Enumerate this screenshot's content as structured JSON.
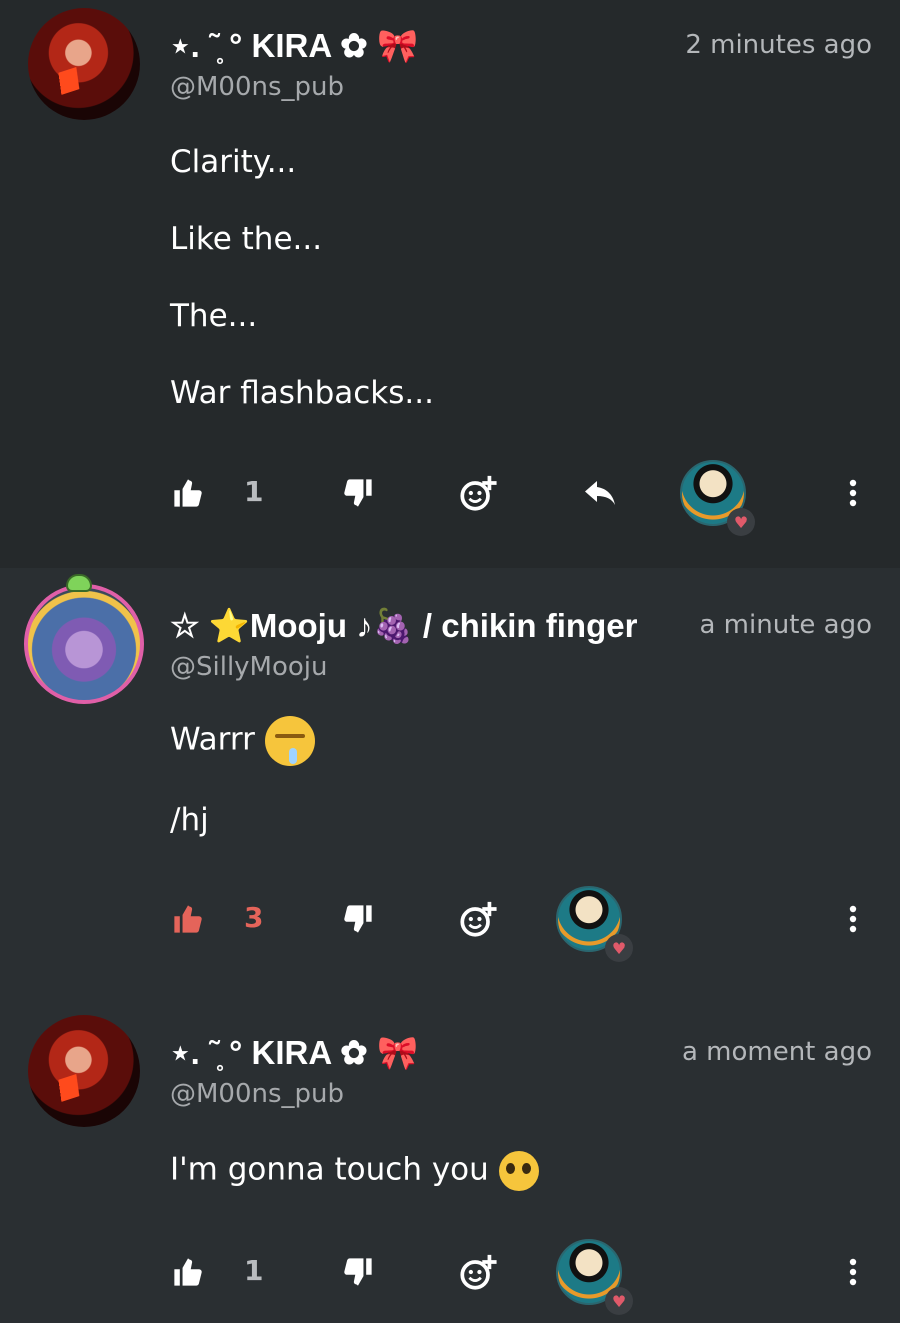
{
  "colors": {
    "background": "#262a2d",
    "text": "#ffffff",
    "muted": "#a6a9ac",
    "liked_accent": "#e4645a"
  },
  "posts": [
    {
      "display_name": "⋆. ῀̥ ° KIRA ✿ 🎀",
      "handle": "@M00ns_pub",
      "time": "2 minutes ago",
      "lines": [
        "Clarity...",
        "Like the...",
        "The...",
        "War flashbacks..."
      ],
      "like_count": "1",
      "liked": false,
      "icons": [
        "thumb-up-icon",
        "thumb-down-icon",
        "add-reaction-icon",
        "reply-icon",
        "more-vertical-icon"
      ]
    },
    {
      "display_name": "☆ ⭐Mooju ♪🍇 / chikin finger",
      "handle": "@SillyMooju",
      "time": "a minute ago",
      "lines": [
        "Warrr",
        "/hj"
      ],
      "emoji": "drooling-face",
      "like_count": "3",
      "liked": true,
      "icons": [
        "thumb-up-icon",
        "thumb-down-icon",
        "add-reaction-icon",
        "more-vertical-icon"
      ]
    },
    {
      "display_name": "⋆. ῀̥ ° KIRA ✿ 🎀",
      "handle": "@M00ns_pub",
      "time": "a moment ago",
      "lines": [
        "I'm gonna touch you"
      ],
      "emoji": "pleading-face",
      "like_count": "1",
      "liked": false,
      "icons": [
        "thumb-up-icon",
        "thumb-down-icon",
        "add-reaction-icon",
        "more-vertical-icon"
      ]
    }
  ]
}
